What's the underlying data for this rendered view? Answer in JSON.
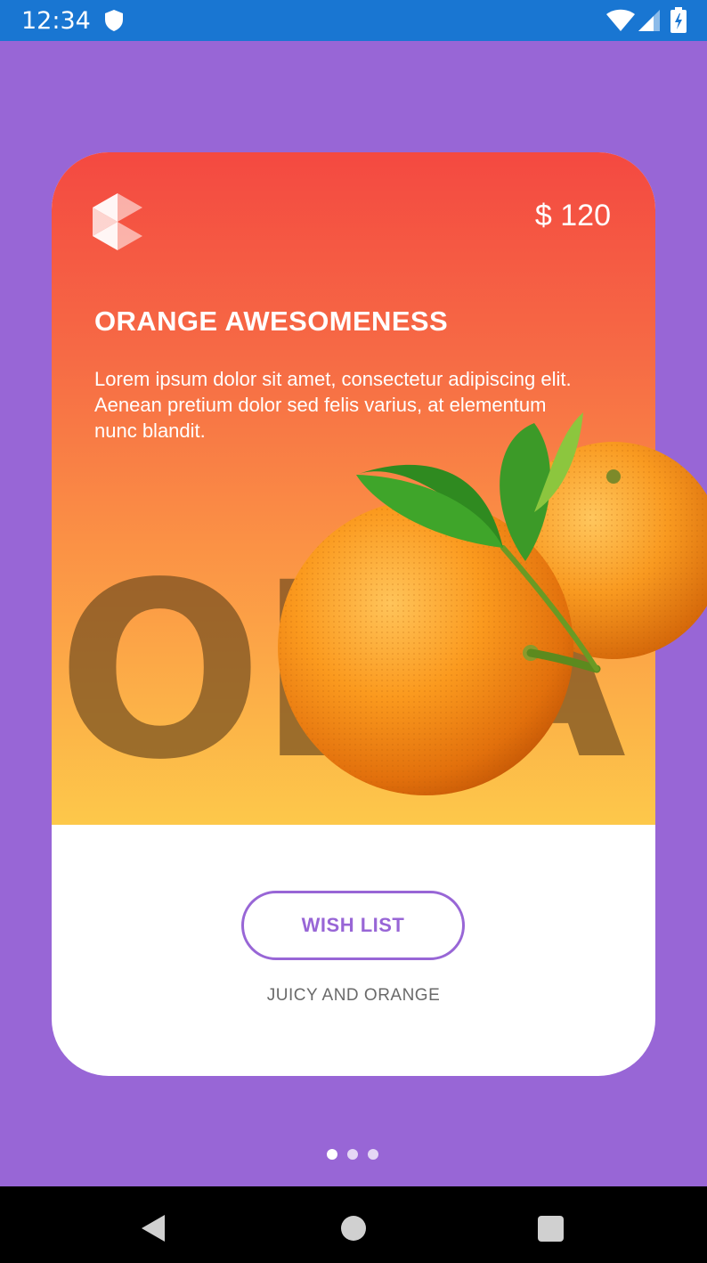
{
  "status_bar": {
    "time": "12:34",
    "icons": [
      "shield-icon",
      "wifi-icon",
      "signal-icon",
      "battery-icon"
    ]
  },
  "card": {
    "price": "$ 120",
    "title": "ORANGE AWESOMENESS",
    "description": "Lorem ipsum dolor sit amet, consectetur adipiscing elit. Aenean pretium dolor sed felis varius, at elementum nunc blandit.",
    "background_word": "ORA",
    "wish_list_label": "WISH LIST",
    "tagline": "JUICY AND ORANGE",
    "gradient": [
      "#f44941",
      "#fdc84a"
    ]
  },
  "pager": {
    "count": 3,
    "active_index": 0
  },
  "nav_bar": {
    "icons": [
      "back-icon",
      "home-icon",
      "recents-icon"
    ]
  },
  "colors": {
    "background": "#9866d6",
    "status_bar": "#1976d2",
    "accent": "#9866d6"
  }
}
